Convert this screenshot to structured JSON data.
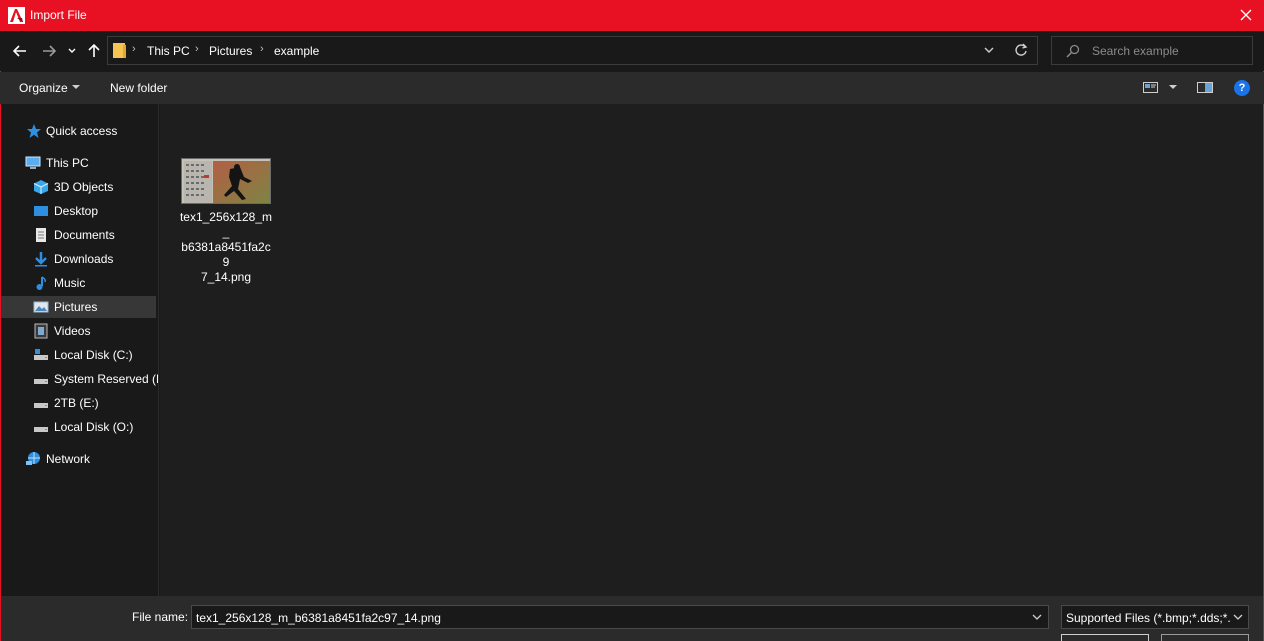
{
  "window": {
    "title": "Import File"
  },
  "address": {
    "crumbs": [
      "This PC",
      "Pictures",
      "example"
    ]
  },
  "search": {
    "placeholder": "Search example"
  },
  "commands": {
    "organize": "Organize",
    "new_folder": "New folder",
    "help": "?"
  },
  "nav": {
    "items": [
      {
        "label": "Quick access",
        "icon": "star-icon"
      },
      {
        "label": "This PC",
        "icon": "computer-icon"
      },
      {
        "label": "3D Objects",
        "icon": "cube-icon"
      },
      {
        "label": "Desktop",
        "icon": "desktop-icon"
      },
      {
        "label": "Documents",
        "icon": "document-icon"
      },
      {
        "label": "Downloads",
        "icon": "download-icon"
      },
      {
        "label": "Music",
        "icon": "music-icon"
      },
      {
        "label": "Pictures",
        "icon": "picture-icon"
      },
      {
        "label": "Videos",
        "icon": "video-icon"
      },
      {
        "label": "Local Disk (C:)",
        "icon": "drive-icon"
      },
      {
        "label": "System Reserved (D",
        "icon": "drive-icon"
      },
      {
        "label": "2TB (E:)",
        "icon": "drive-icon"
      },
      {
        "label": "Local Disk (O:)",
        "icon": "drive-icon"
      },
      {
        "label": "Network",
        "icon": "network-icon"
      }
    ],
    "selected": "Pictures"
  },
  "files": [
    {
      "name": "tex1_256x128_m_b6381a8451fa2c97_14.png",
      "display_lines": [
        "tex1_256x128_m_",
        "b6381a8451fa2c9",
        "7_14.png"
      ]
    }
  ],
  "footer": {
    "file_name_label": "File name:",
    "file_name_value": "tex1_256x128_m_b6381a8451fa2c97_14.png",
    "filter_value": "Supported Files (*.bmp;*.dds;*.g"
  },
  "colors": {
    "accent": "#e81123",
    "background": "#191919",
    "toolbar": "#2b2b2b",
    "selected": "#373737"
  }
}
